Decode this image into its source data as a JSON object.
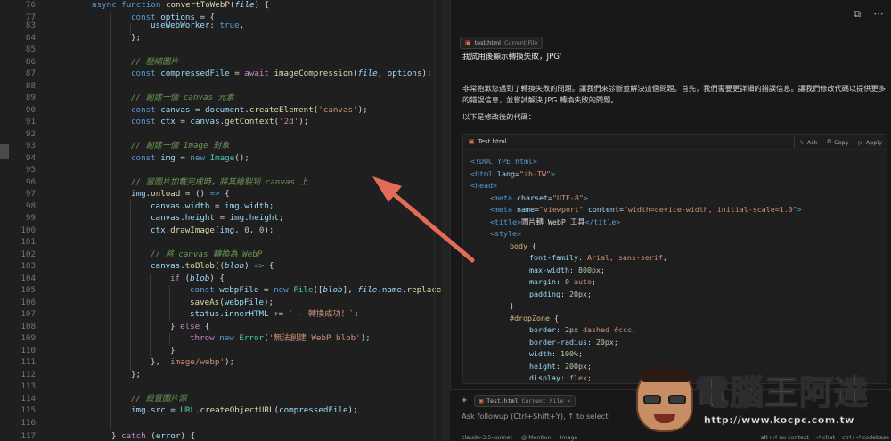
{
  "editor": {
    "lines": [
      {
        "n": "76",
        "t": "async function convertToWebP(file) {"
      },
      {
        "n": "77",
        "t": "const options = {"
      },
      {
        "n": "83",
        "t": "useWebWorker: true,"
      },
      {
        "n": "84",
        "t": "};"
      },
      {
        "n": "85",
        "t": ""
      },
      {
        "n": "86",
        "t": "// 壓縮圖片"
      },
      {
        "n": "87",
        "t": "const compressedFile = await imageCompression(file, options);"
      },
      {
        "n": "88",
        "t": ""
      },
      {
        "n": "89",
        "t": "// 創建一個 canvas 元素"
      },
      {
        "n": "90",
        "t": "const canvas = document.createElement('canvas');"
      },
      {
        "n": "91",
        "t": "const ctx = canvas.getContext('2d');"
      },
      {
        "n": "92",
        "t": ""
      },
      {
        "n": "93",
        "t": "// 創建一個 Image 對象"
      },
      {
        "n": "94",
        "t": "const img = new Image();"
      },
      {
        "n": "95",
        "t": ""
      },
      {
        "n": "96",
        "t": "// 當圖片加載完成時，將其繪製到 canvas 上"
      },
      {
        "n": "97",
        "t": "img.onload = () => {"
      },
      {
        "n": "98",
        "t": "canvas.width = img.width;"
      },
      {
        "n": "99",
        "t": "canvas.height = img.height;"
      },
      {
        "n": "100",
        "t": "ctx.drawImage(img, 0, 0);"
      },
      {
        "n": "101",
        "t": ""
      },
      {
        "n": "102",
        "t": "// 將 canvas 轉換為 WebP"
      },
      {
        "n": "103",
        "t": "canvas.toBlob((blob) => {"
      },
      {
        "n": "104",
        "t": "if (blob) {"
      },
      {
        "n": "105",
        "t": "const webpFile = new File([blob], file.name.replace(/"
      },
      {
        "n": "106",
        "t": "saveAs(webpFile);"
      },
      {
        "n": "107",
        "t": "status.innerHTML += ` - 轉換成功！`;"
      },
      {
        "n": "108",
        "t": "} else {"
      },
      {
        "n": "109",
        "t": "throw new Error('無法創建 WebP blob');"
      },
      {
        "n": "110",
        "t": "}"
      },
      {
        "n": "111",
        "t": "}, 'image/webp');"
      },
      {
        "n": "112",
        "t": "};"
      },
      {
        "n": "113",
        "t": ""
      },
      {
        "n": "114",
        "t": "// 設置圖片源"
      },
      {
        "n": "115",
        "t": "img.src = URL.createObjectURL(compressedFile);"
      },
      {
        "n": "116",
        "t": ""
      },
      {
        "n": "117",
        "t": "} catch (error) {"
      }
    ]
  },
  "chat": {
    "context_chip": {
      "file": "test.html",
      "tag": "Current File"
    },
    "user_message": "我試用後顯示轉換失敗，JPG'",
    "assistant_paragraph1": "非常抱歉您遇到了轉換失敗的問題。讓我們來診斷並解決這個問題。首先，我們需要更詳細的錯誤信息。讓我們修改代碼以提供更多的錯誤信息，並嘗試解決 JPG 轉換失敗的問題。",
    "assistant_paragraph2": "以下是修改後的代碼：",
    "codeblock": {
      "filename": "Test.html",
      "ask_label": "Ask",
      "copy_label": "Copy",
      "apply_label": "Apply",
      "lines": [
        "<!DOCTYPE html>",
        "<html lang=\"zh-TW\">",
        "<head>",
        "<meta charset=\"UTF-8\">",
        "<meta name=\"viewport\" content=\"width=device-width, initial-scale=1.0\">",
        "<title>圖片轉 WebP 工具</title>",
        "<style>",
        "body {",
        "font-family: Arial, sans-serif;",
        "max-width: 800px;",
        "margin: 0 auto;",
        "padding: 20px;",
        "}",
        "#dropZone {",
        "border: 2px dashed #ccc;",
        "border-radius: 20px;",
        "width: 100%;",
        "height: 200px;",
        "display: flex;"
      ]
    },
    "input": {
      "add_label": "+",
      "chip": {
        "file": "Test.html",
        "tag": "Current File"
      },
      "placeholder": "Ask followup (Ctrl+Shift+Y), ↑ to select",
      "footer": {
        "model": "claude-3.5-sonnet",
        "mention": "@ Mention",
        "image": "Image",
        "no_context": "alt+⏎ no context",
        "chat": "⏎ chat",
        "codebase": "ctrl+⏎ codebase"
      }
    }
  },
  "watermark": {
    "title": "電腦王阿達",
    "url": "http://www.kocpc.com.tw"
  },
  "icons": {
    "copy": "copy-icon",
    "more": "more-icon",
    "file": "html-file-icon",
    "arrow": "red-annotation-arrow"
  },
  "colors": {
    "annotation_arrow": "#e36b58",
    "html_file_icon": "#e06c4f"
  }
}
